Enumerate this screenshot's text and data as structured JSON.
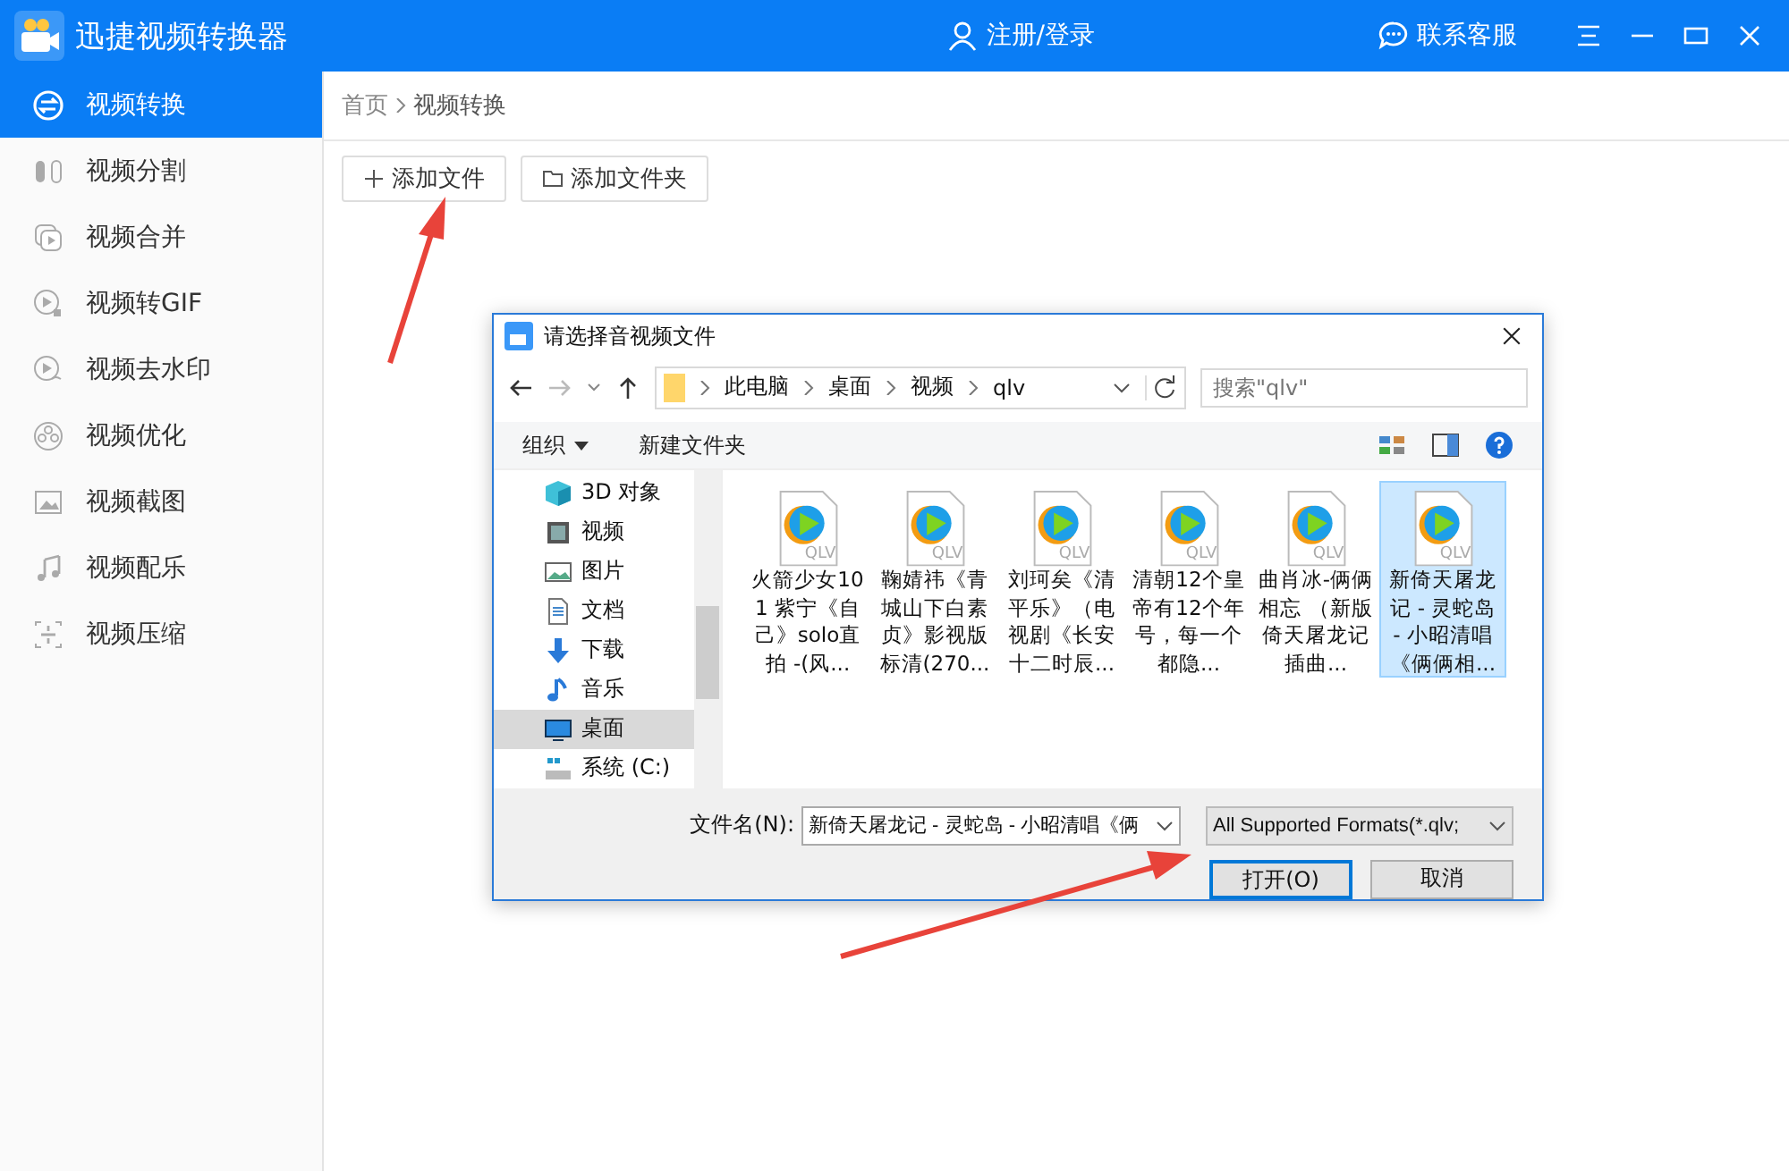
{
  "app": {
    "title": "迅捷视频转换器",
    "login": "注册/登录",
    "support": "联系客服"
  },
  "sidebar": {
    "items": [
      {
        "label": "视频转换",
        "kind": "convert",
        "selected": true
      },
      {
        "label": "视频分割",
        "kind": "split",
        "selected": false
      },
      {
        "label": "视频合并",
        "kind": "merge",
        "selected": false
      },
      {
        "label": "视频转GIF",
        "kind": "gif",
        "selected": false
      },
      {
        "label": "视频去水印",
        "kind": "watermark",
        "selected": false
      },
      {
        "label": "视频优化",
        "kind": "optimize",
        "selected": false
      },
      {
        "label": "视频截图",
        "kind": "screenshot",
        "selected": false
      },
      {
        "label": "视频配乐",
        "kind": "music",
        "selected": false
      },
      {
        "label": "视频压缩",
        "kind": "compress",
        "selected": false
      }
    ]
  },
  "breadcrumb": [
    "首页",
    "视频转换"
  ],
  "toolbar": [
    {
      "label": "添加文件",
      "kind": "add"
    },
    {
      "label": "添加文件夹",
      "kind": "folder"
    }
  ],
  "dialog": {
    "title": "请选择音视频文件",
    "path": [
      "此电脑",
      "桌面",
      "视频",
      "qlv"
    ],
    "search": {
      "placeholder": "搜索\"qlv\""
    },
    "organize": "组织",
    "new_folder": "新建文件夹",
    "nav": [
      {
        "label": "3D 对象",
        "kind": "cube",
        "selected": false
      },
      {
        "label": "视频",
        "kind": "video",
        "selected": false
      },
      {
        "label": "图片",
        "kind": "image",
        "selected": false
      },
      {
        "label": "文档",
        "kind": "doc",
        "selected": false
      },
      {
        "label": "下载",
        "kind": "download",
        "selected": false
      },
      {
        "label": "音乐",
        "kind": "music",
        "selected": false
      },
      {
        "label": "桌面",
        "kind": "desktop",
        "selected": true
      },
      {
        "label": "系统 (C:)",
        "kind": "drive",
        "selected": false
      }
    ],
    "files": [
      {
        "name": "火箭少女101 紫宁《自己》solo直拍 -(风...",
        "badge": "QLV",
        "selected": false
      },
      {
        "name": "鞠婧祎《青城山下白素贞》影视版标清(270...",
        "badge": "QLV",
        "selected": false
      },
      {
        "name": "刘珂矣《清平乐》（电视剧《长安十二时辰...",
        "badge": "QLV",
        "selected": false
      },
      {
        "name": "清朝12个皇帝有12个年号，每一个都隐...",
        "badge": "QLV",
        "selected": false
      },
      {
        "name": "曲肖冰-俩俩相忘 （新版倚天屠龙记插曲...",
        "badge": "QLV",
        "selected": false
      },
      {
        "name": "新倚天屠龙记 - 灵蛇岛 - 小昭清唱《俩俩相...",
        "badge": "QLV",
        "selected": true
      }
    ],
    "filename_label": "文件名(N):",
    "filename": "新倚天屠龙记 - 灵蛇岛 - 小昭清唱《俩",
    "filter": "All Supported Formats(*.qlv;",
    "open": "打开(O)",
    "cancel": "取消"
  }
}
